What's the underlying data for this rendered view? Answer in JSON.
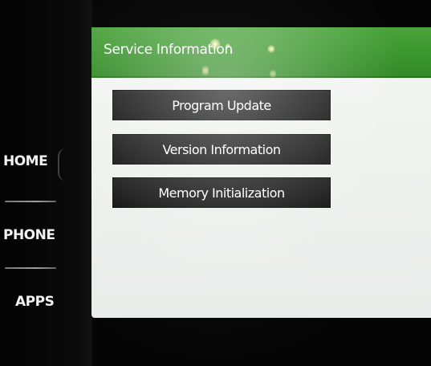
{
  "side_nav": {
    "home_label": "HOME",
    "phone_label": "PHONE",
    "apps_label": "APPS"
  },
  "screen": {
    "title": "Service Information",
    "header_color": "#3c962f",
    "buttons": [
      {
        "label": "Program Update"
      },
      {
        "label": "Version Information"
      },
      {
        "label": "Memory Initialization"
      }
    ]
  }
}
